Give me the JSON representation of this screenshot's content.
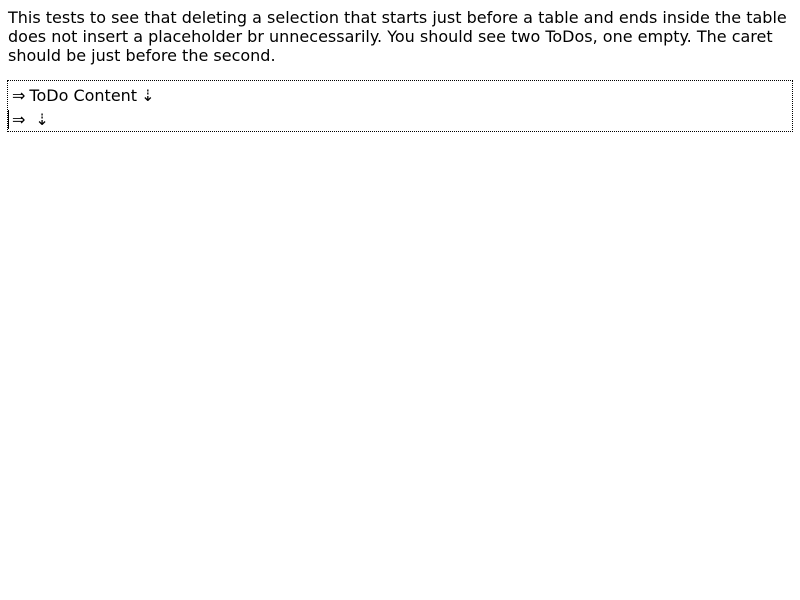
{
  "description": "This tests to see that deleting a selection that starts just before a table and ends inside the table does not insert a placeholder br unnecessarily. You should see two ToDos, one empty. The caret should be just before the second.",
  "todos": [
    {
      "start_marker": "⇒",
      "content": "ToDo Content",
      "end_marker": "⇣"
    },
    {
      "start_marker": "⇒",
      "content": "",
      "end_marker": "⇣"
    }
  ]
}
